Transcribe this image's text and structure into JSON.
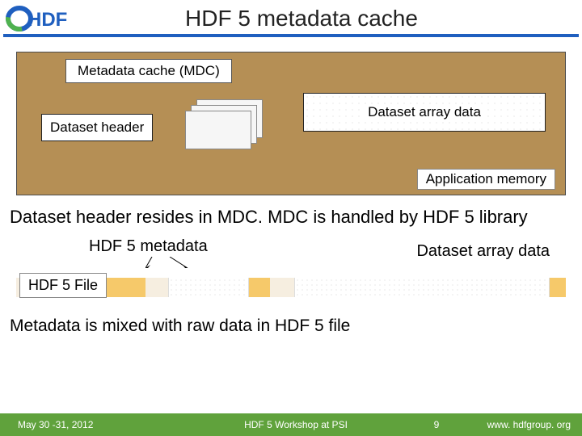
{
  "header": {
    "logo_text": "HDF",
    "title": "HDF 5 metadata cache"
  },
  "mdc": {
    "label": "Metadata cache (MDC)",
    "dataset_header": "Dataset header",
    "array_label": "Dataset array data",
    "app_memory": "Application memory"
  },
  "body1": "Dataset header resides in MDC. MDC is handled by HDF 5 library",
  "filestrip": {
    "meta_label": "HDF 5 metadata",
    "array_label": "Dataset array data",
    "file_label": "HDF 5 File"
  },
  "body2": "Metadata is mixed with raw data in HDF 5 file",
  "footer": {
    "date": "May 30 -31, 2012",
    "center": "HDF 5 Workshop at PSI",
    "page": "9",
    "url": "www. hdfgroup. org"
  }
}
